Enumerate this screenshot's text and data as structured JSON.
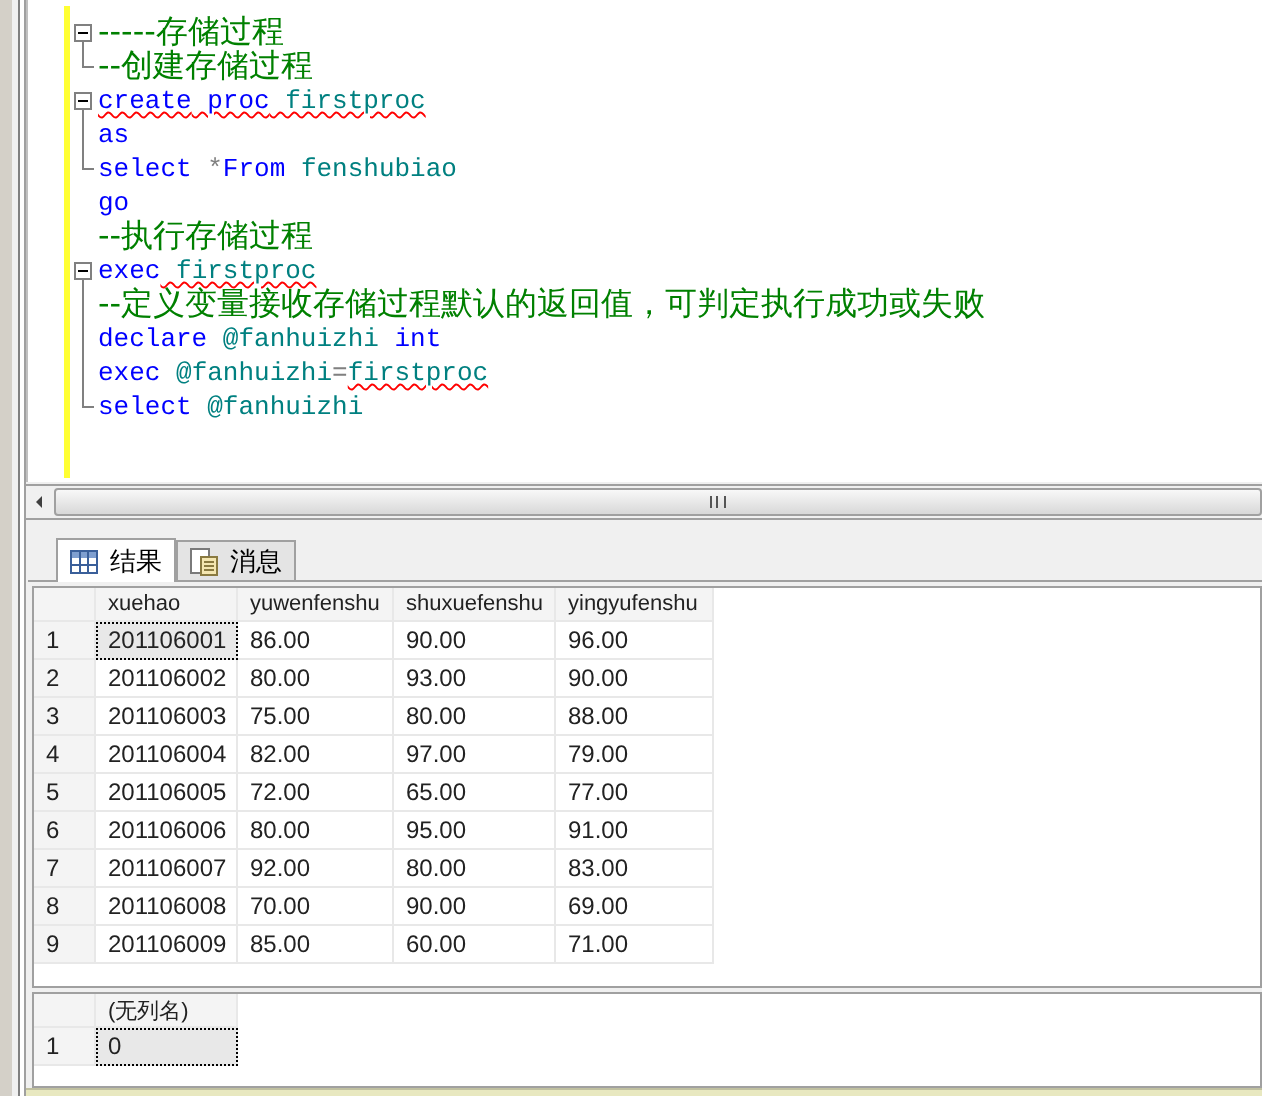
{
  "editor": {
    "lines": [
      {
        "kind": "fold-start",
        "tokens": [
          {
            "kind": "comment",
            "text": "-----存储过程"
          }
        ]
      },
      {
        "kind": "fold-end",
        "tokens": [
          {
            "kind": "comment",
            "text": "--创建存储过程"
          }
        ]
      },
      {
        "kind": "fold-start",
        "tokens": [
          {
            "kind": "keyword",
            "text": "create",
            "error": true
          },
          {
            "kind": "keyword",
            "text": " proc",
            "error": true
          },
          {
            "kind": "identifier",
            "text": " firstproc",
            "error": true
          }
        ]
      },
      {
        "kind": "fold-middle",
        "tokens": [
          {
            "kind": "keyword",
            "text": "as"
          }
        ]
      },
      {
        "kind": "fold-end",
        "tokens": [
          {
            "kind": "keyword",
            "text": "select"
          },
          {
            "kind": "operator",
            "text": " *"
          },
          {
            "kind": "keyword",
            "text": "From"
          },
          {
            "kind": "identifier",
            "text": " fenshubiao"
          }
        ]
      },
      {
        "kind": "plain",
        "tokens": [
          {
            "kind": "keyword",
            "text": "go"
          }
        ]
      },
      {
        "kind": "plain",
        "tokens": [
          {
            "kind": "comment",
            "text": "--执行存储过程"
          }
        ]
      },
      {
        "kind": "fold-start",
        "tokens": [
          {
            "kind": "keyword",
            "text": "exec"
          },
          {
            "kind": "identifier",
            "text": " firstproc",
            "error": true
          }
        ]
      },
      {
        "kind": "fold-middle",
        "tokens": [
          {
            "kind": "comment",
            "text": "--定义变量接收存储过程默认的返回值，可判定执行成功或失败"
          }
        ]
      },
      {
        "kind": "fold-middle",
        "tokens": [
          {
            "kind": "keyword",
            "text": "declare"
          },
          {
            "kind": "identifier",
            "text": " @fanhuizhi"
          },
          {
            "kind": "keyword",
            "text": " int"
          }
        ]
      },
      {
        "kind": "fold-middle",
        "tokens": [
          {
            "kind": "keyword",
            "text": "exec"
          },
          {
            "kind": "identifier",
            "text": " @fanhuizhi"
          },
          {
            "kind": "operator",
            "text": "="
          },
          {
            "kind": "identifier",
            "text": "firstproc",
            "error": true
          }
        ]
      },
      {
        "kind": "fold-end",
        "tokens": [
          {
            "kind": "keyword",
            "text": "select"
          },
          {
            "kind": "identifier",
            "text": " @fanhuizhi"
          }
        ]
      }
    ]
  },
  "tabs": [
    {
      "label": "结果",
      "kind": "grid",
      "selected": true
    },
    {
      "label": "消息",
      "kind": "messages",
      "selected": false
    }
  ],
  "grids": [
    {
      "columns": [
        "xuehao",
        "yuwenfenshu",
        "shuxuefenshu",
        "yingyufenshu"
      ],
      "rows": [
        {
          "number": "1",
          "selected": true,
          "cells": [
            "201106001",
            "86.00",
            "90.00",
            "96.00"
          ]
        },
        {
          "number": "2",
          "selected": false,
          "cells": [
            "201106002",
            "80.00",
            "93.00",
            "90.00"
          ]
        },
        {
          "number": "3",
          "selected": false,
          "cells": [
            "201106003",
            "75.00",
            "80.00",
            "88.00"
          ]
        },
        {
          "number": "4",
          "selected": false,
          "cells": [
            "201106004",
            "82.00",
            "97.00",
            "79.00"
          ]
        },
        {
          "number": "5",
          "selected": false,
          "cells": [
            "201106005",
            "72.00",
            "65.00",
            "77.00"
          ]
        },
        {
          "number": "6",
          "selected": false,
          "cells": [
            "201106006",
            "80.00",
            "95.00",
            "91.00"
          ]
        },
        {
          "number": "7",
          "selected": false,
          "cells": [
            "201106007",
            "92.00",
            "80.00",
            "83.00"
          ]
        },
        {
          "number": "8",
          "selected": false,
          "cells": [
            "201106008",
            "70.00",
            "90.00",
            "69.00"
          ]
        },
        {
          "number": "9",
          "selected": false,
          "cells": [
            "201106009",
            "85.00",
            "60.00",
            "71.00"
          ]
        }
      ]
    },
    {
      "columns": [
        "(无列名)"
      ],
      "rows": [
        {
          "number": "1",
          "selected": true,
          "cells": [
            "0"
          ]
        }
      ]
    }
  ]
}
